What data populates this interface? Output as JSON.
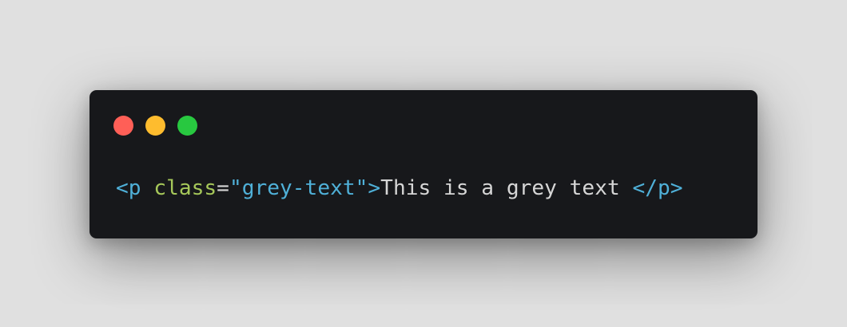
{
  "window": {
    "background": "#17181b",
    "controls": [
      {
        "name": "close",
        "color": "#ff5f57"
      },
      {
        "name": "minimize",
        "color": "#febc2e"
      },
      {
        "name": "maximize",
        "color": "#28c840"
      }
    ]
  },
  "theme": {
    "tag": "#4fb0d8",
    "attr": "#a6c85a",
    "punct": "#d6d6d6",
    "string": "#4fb0d8",
    "text": "#d6d6d6"
  },
  "code": {
    "open_tag": "<p",
    "space": " ",
    "attr_name": "class",
    "equals": "=",
    "attr_value": "\"grey-text\"",
    "open_tag_close": ">",
    "inner_text": "This is a grey text ",
    "close_tag": "</p>"
  }
}
